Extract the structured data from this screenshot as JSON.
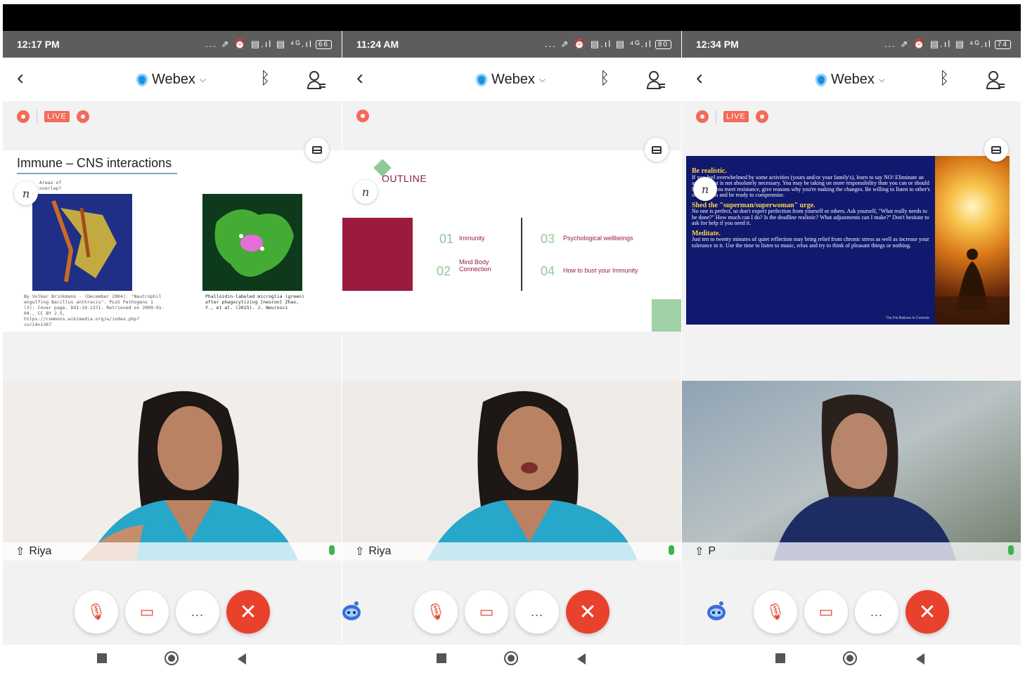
{
  "panels": [
    {
      "status": {
        "time": "12:17 PM",
        "icons": "... ⇗ ⏰ ▤.ıl ▤ ⁴ᴳ.ıl",
        "battery": "66"
      },
      "app": {
        "title": "Webex"
      },
      "live": true,
      "live_label": "LIVE",
      "slide": {
        "title": "Immune – CNS interactions",
        "left_label": "Areas of overlap?",
        "caption_left": "By Volker Brinkmann - (December 2004). \"Neutrophil engulfing Bacillus anthracis\". PLoS Pathogens 1 (3): Cover page. DOI:10.1371. Retrieved on 2009-01-04., CC BY 2.5, https://commons.wikimedia.org/w/index.php?curid=1367",
        "caption_right": "Phalloidin-labeled microglia (green) after phagocytizing [neuron] Zhao, Y., et al. (2015). J. Neurosci"
      },
      "participant": "Riya",
      "controls": {
        "more": "..."
      }
    },
    {
      "status": {
        "time": "11:24 AM",
        "icons": "... ⇗ ⏰ ▤.ıl ▤ ⁴ᴳ.ıl",
        "battery": "80"
      },
      "app": {
        "title": "Webex"
      },
      "live": false,
      "slide": {
        "heading": "OUTLINE",
        "items": [
          {
            "num": "01",
            "text": "Immunity"
          },
          {
            "num": "02",
            "text": "Mind Body Connection"
          },
          {
            "num": "03",
            "text": "Psychological wellbeings"
          },
          {
            "num": "04",
            "text": "How to bust your Immunity"
          }
        ]
      },
      "participant": "Riya",
      "controls": {
        "more": "..."
      }
    },
    {
      "status": {
        "time": "12:34 PM",
        "icons": "... ⇗ ⏰ ▤.ıl ▤ ⁴ᴳ.ıl",
        "battery": "74"
      },
      "app": {
        "title": "Webex"
      },
      "live": true,
      "live_label": "LIVE",
      "slide": {
        "h1": "Be realistic.",
        "p1": "If you feel overwhelmed by some activities (yours and/or your family's), learn to say NO! Eliminate an activity that is not absolutely necessary. You may be taking on more responsibility than you can or should handle. If you meet resistance, give reasons why you're making the changes. Be willing to listen to other's suggestions and be ready to compromise.",
        "h2": "Shed the \"superman/superwoman\" urge.",
        "p2": "No one is perfect, so don't expect perfection from yourself or others. Ask yourself, \"What really needs to be done?\" How much can I do? Is the deadline realistic? What adjustments can I make?\" Don't hesitate to ask for help if you need it.",
        "h3": "Meditate.",
        "p3": "Just ten to twenty minutes of quiet reflection may bring relief from chronic stress as well as increase your tolerance to it. Use the time to listen to music, relax and try to think of pleasant things or nothing.",
        "footer": "The Pot Bellows In Controle"
      },
      "participant": "P",
      "controls": {
        "more": "..."
      }
    }
  ],
  "colors": {
    "accent": "#e8422d",
    "statusbar": "#5d5d5d",
    "mic_on": "#3bb54a"
  }
}
